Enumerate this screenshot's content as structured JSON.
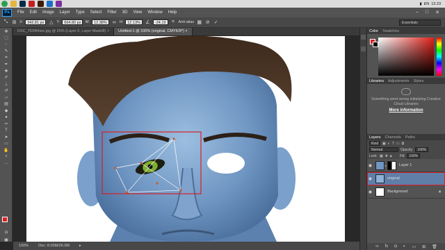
{
  "taskbar": {
    "icons": [
      "chrome-icon",
      "explorer-icon",
      "photoshop-icon",
      "acrobat-icon",
      "illustrator-icon",
      "media-icon",
      "app-icon"
    ],
    "lang": "EN",
    "clock": "13.23"
  },
  "menubar": {
    "logo": "Ps",
    "items": [
      "File",
      "Edit",
      "Image",
      "Layer",
      "Type",
      "Select",
      "Filter",
      "3D",
      "View",
      "Window",
      "Help"
    ]
  },
  "options": {
    "x_label": "X:",
    "x_value": "342.81 px",
    "y_label": "Y:",
    "y_value": "664.80 px",
    "w_label": "W:",
    "w_value": "12.38%",
    "h_label": "H:",
    "h_value": "12.13%",
    "angle_value": "-24.19",
    "antialias": "Anti-alias",
    "workspace": "Essentials"
  },
  "tabs": [
    {
      "label": "DSC_7534hhee.jpg @ 25% (Layer 0, Layer Mask/8) ×"
    },
    {
      "label": "Untitled-1 @ 100% (original, CMYK/8*) ×"
    }
  ],
  "status": {
    "zoom": "100%",
    "doc": "Doc: 8.03M/26.0M"
  },
  "panels": {
    "color_tabs": [
      "Color",
      "Swatches"
    ],
    "lib_tabs": [
      "Libraries",
      "Adjustments",
      "Styles"
    ],
    "lib_message": "Something went wrong initializing Creative Cloud Libraries",
    "lib_link": "More information",
    "layer_tabs": [
      "Layers",
      "Channels",
      "Paths"
    ],
    "kind_label": "Kind",
    "blend_mode": "Normal",
    "opacity_label": "Opacity:",
    "opacity_value": "100%",
    "lock_label": "Lock:",
    "fill_label": "Fill:",
    "fill_value": "100%",
    "layers": [
      {
        "name": "Layer 1"
      },
      {
        "name": "original"
      },
      {
        "name": "Background"
      }
    ]
  },
  "colors": {
    "foreground": "#e02020",
    "background": "#000000",
    "selection_highlight": "#d81f26"
  }
}
